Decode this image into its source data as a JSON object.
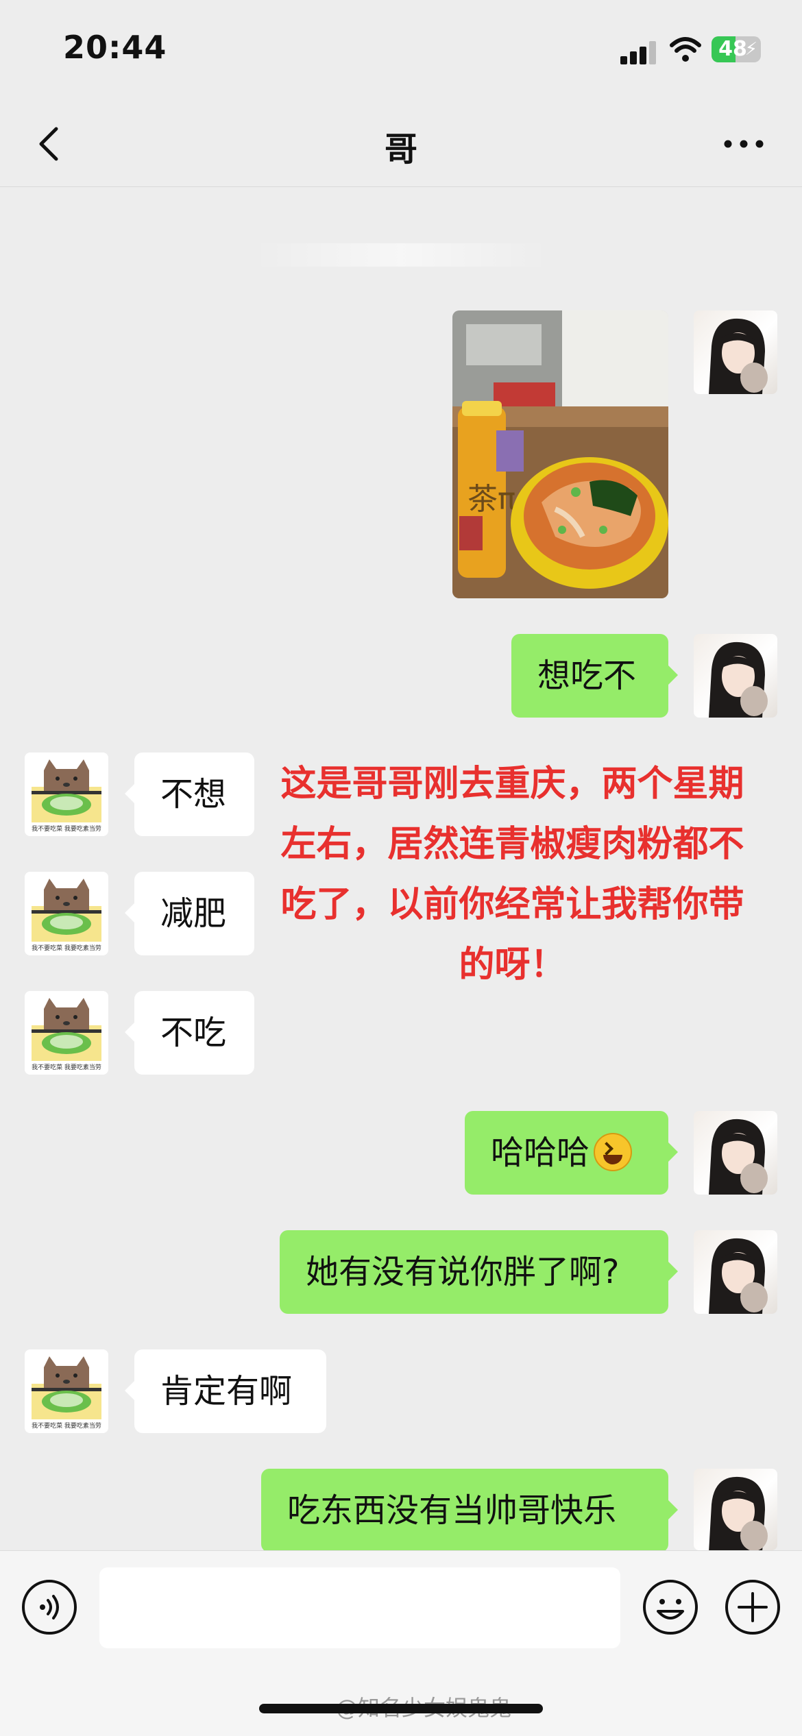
{
  "status_bar": {
    "time": "20:44",
    "battery_level": "48"
  },
  "nav": {
    "title": "哥"
  },
  "photo_message": {
    "bottle_label": "茶π"
  },
  "messages": {
    "m1": "想吃不",
    "m2": "不想",
    "m3": "减肥",
    "m4": "不吃",
    "m5": "哈哈哈",
    "m6": "她有没有说你胖了啊?",
    "m7": "肯定有啊",
    "m8": "吃东西没有当帅哥快乐"
  },
  "sticker_text": "我不要吃菜 我要吃素当劳",
  "overlay_annotation": "这是哥哥刚去重庆，两个星期左右，居然连青椒瘦肉粉都不吃了，以前你经常让我帮你带的呀！",
  "watermark": "@知名少女娱鬼鬼",
  "colors": {
    "bubble_self": "#95ec69",
    "bubble_other": "#ffffff",
    "background": "#ededed",
    "annotation": "#e8302e"
  }
}
